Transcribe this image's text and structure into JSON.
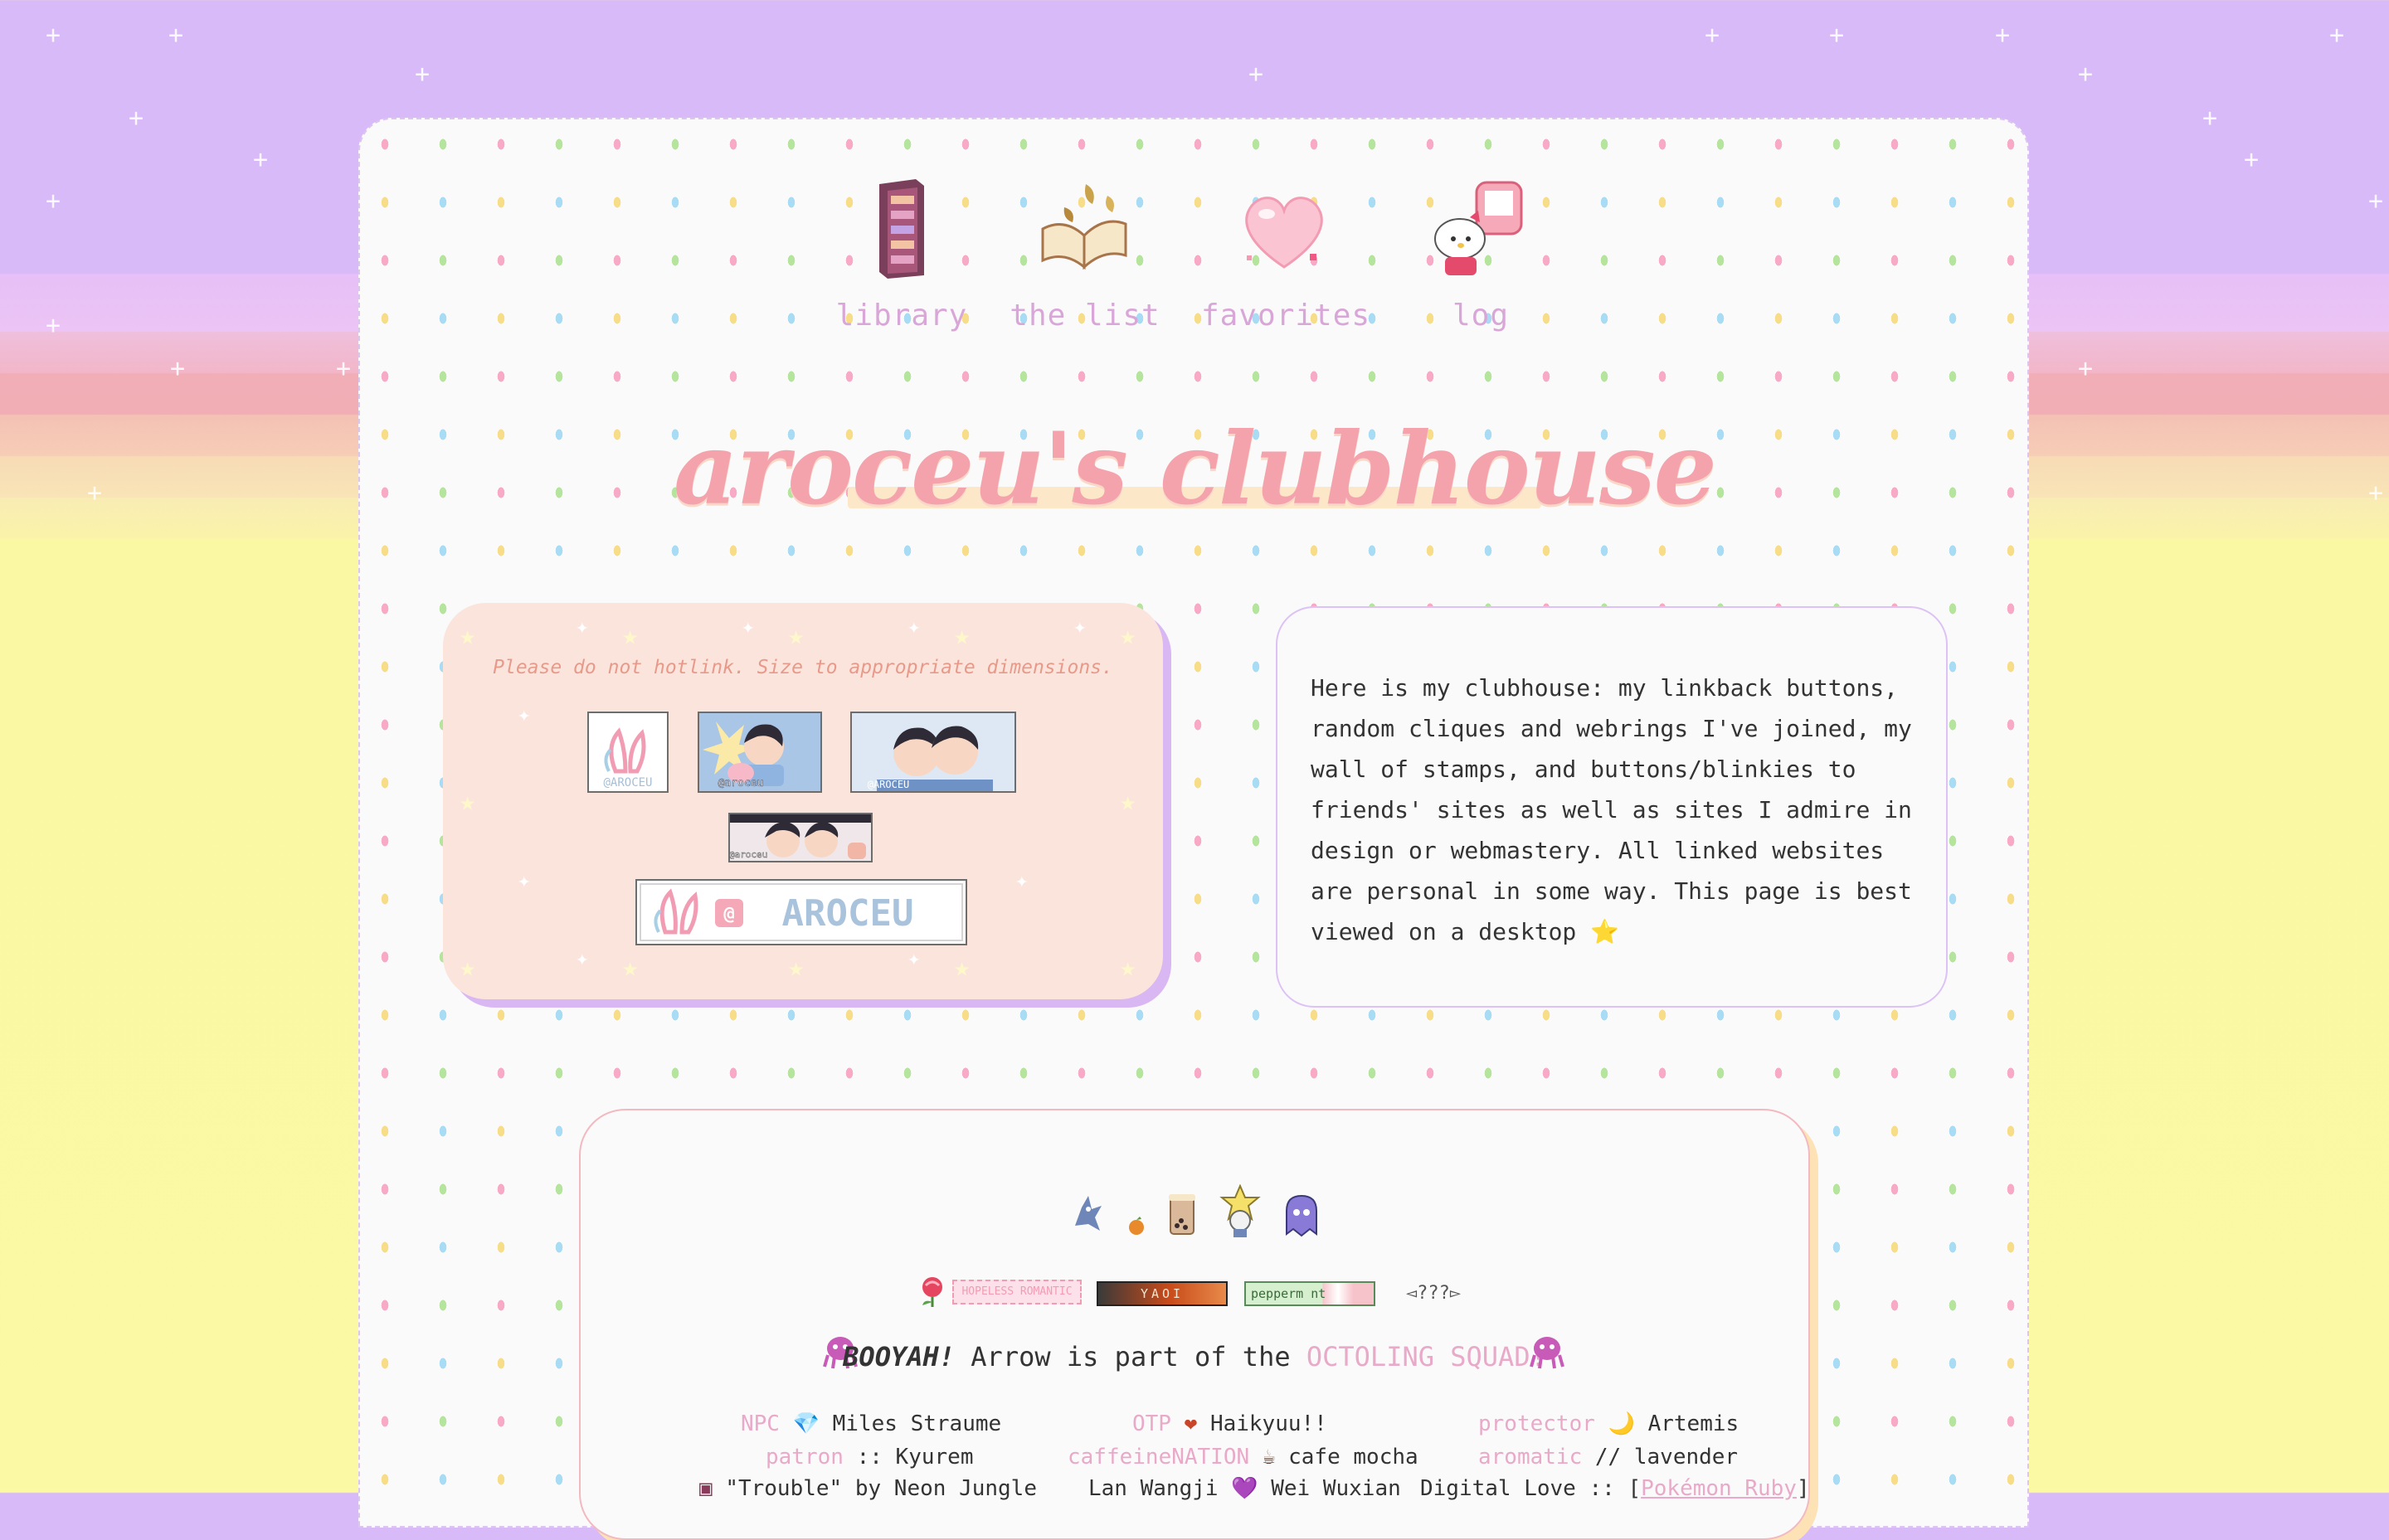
{
  "nav": {
    "items": [
      {
        "label": "library",
        "icon": "bookshelf-icon"
      },
      {
        "label": "the list",
        "icon": "open-book-icon"
      },
      {
        "label": "favorites",
        "icon": "heart-icon"
      },
      {
        "label": "log",
        "icon": "hello-kitty-icon"
      }
    ]
  },
  "title": "aroceu's clubhouse",
  "buttons_box": {
    "notice": "Please do not hotlink. Size to appropriate dimensions.",
    "wide_button_text": "AROCEU",
    "small_button_caption": "@aroceu"
  },
  "about": {
    "text": "Here is my clubhouse: my linkback buttons, random cliques and webrings I've joined, my wall of stamps, and buttons/blinkies to friends' sites as well as sites I admire in design or webmastery. All linked websites are personal in some way. This page is best viewed on a desktop"
  },
  "blinkies": {
    "romantic": "HOPELESS ROMANTIC",
    "yaoi": "YAOI",
    "peppermint": "pepperm nt",
    "unknown": "???"
  },
  "squad": {
    "booyah": "BOOYAH!",
    "middle": " Arrow is part of the ",
    "squad_name": "OCTOLING SQUAD!"
  },
  "fans": {
    "row1": [
      {
        "label": "NPC",
        "sep": "💎",
        "value": "Miles Straume"
      },
      {
        "label": "OTP",
        "sep": "❤",
        "value": "Haikyuu!!"
      },
      {
        "label": "protector",
        "sep": "🌙",
        "value": "Artemis"
      }
    ],
    "row2": [
      {
        "label": "patron",
        "sep": "::",
        "value": "Kyurem"
      },
      {
        "label": "caffeineNATION",
        "sep": "☕",
        "value": "cafe mocha"
      },
      {
        "label": "aromatic",
        "sep": "//",
        "value": "lavender"
      }
    ],
    "row3": [
      {
        "prefix": "\"Trouble\" by Neon Jungle"
      },
      {
        "prefix": "Lan Wangji",
        "sep": "💜",
        "value": "Wei Wuxian"
      },
      {
        "prefix": "Digital Love :: [",
        "link": "Pokémon Ruby",
        "suffix": "]"
      }
    ]
  },
  "colors": {
    "sky_purple": "#d7baf7",
    "sky_yellow": "#fbf9a3",
    "nav_label": "#d9a6d8",
    "title_pink": "#f4a3ad",
    "accent_pink": "#e9a9c9"
  }
}
